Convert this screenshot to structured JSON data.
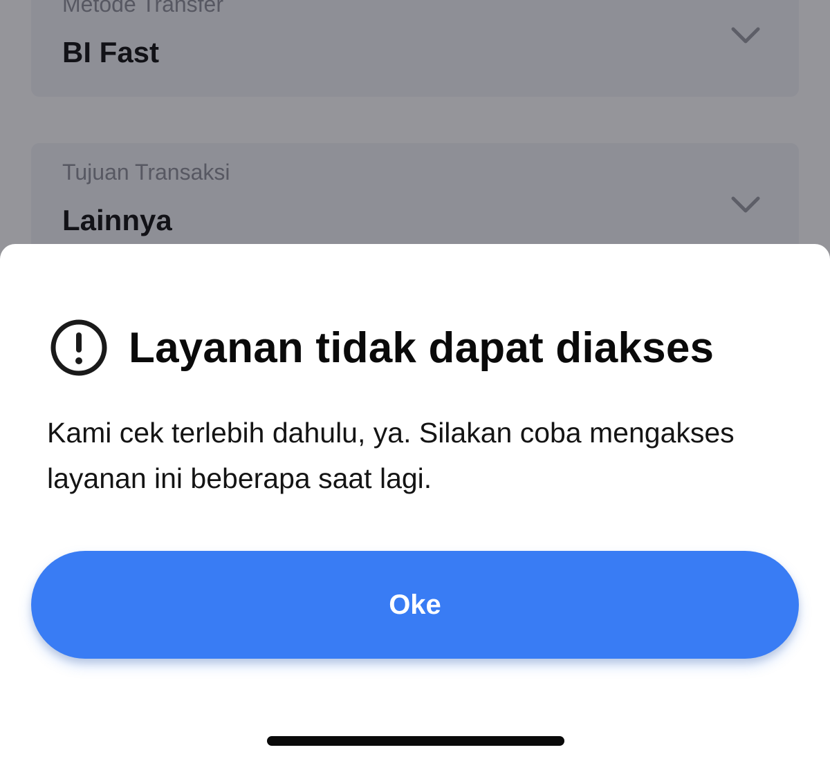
{
  "form": {
    "method_label": "Metode Transfer",
    "method_value": "BI Fast",
    "purpose_label": "Tujuan Transaksi",
    "purpose_value": "Lainnya"
  },
  "dialog": {
    "icon": "exclamation-circle-icon",
    "title": "Layanan tidak dapat diakses",
    "message": "Kami cek terlebih dahulu, ya. Silakan coba mengakses layanan ini beberapa saat lagi.",
    "ok_label": "Oke"
  },
  "colors": {
    "primary_button": "#397cf4",
    "overlay": "rgba(20,20,30,0.45)"
  }
}
